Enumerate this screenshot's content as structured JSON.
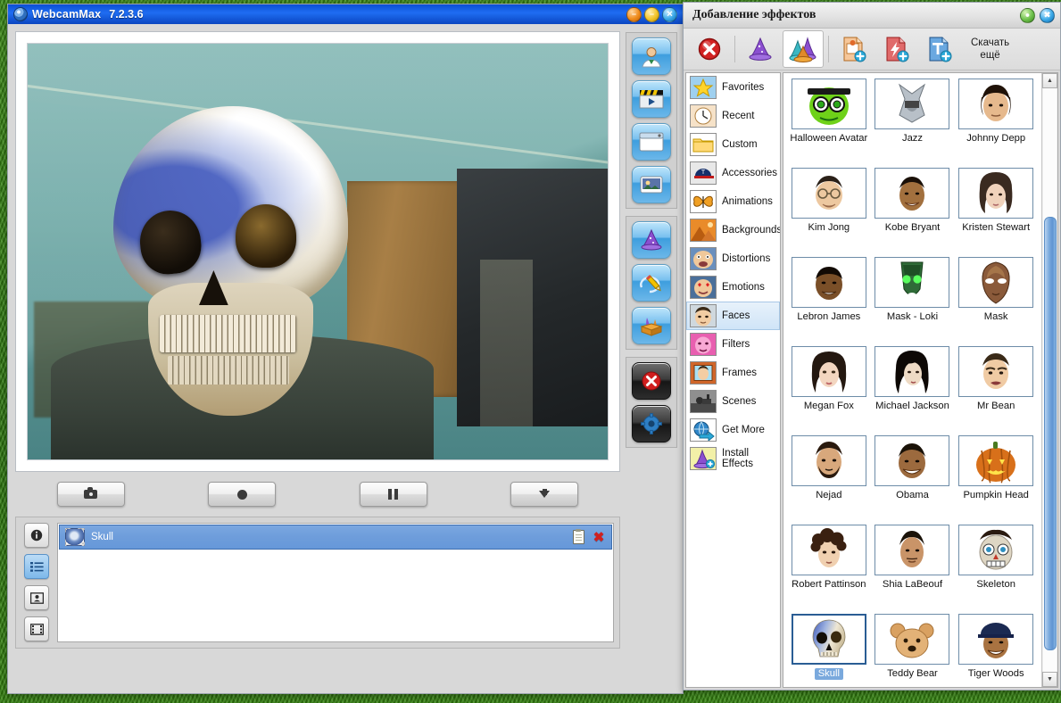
{
  "main_window": {
    "title": "WebcamMax",
    "version": "7.2.3.6",
    "window_buttons": [
      {
        "name": "minimize",
        "glyph": "–"
      },
      {
        "name": "maximize",
        "glyph": "–"
      },
      {
        "name": "close",
        "glyph": "✕"
      }
    ],
    "media_buttons": [
      {
        "name": "snapshot",
        "icon": "camera-icon"
      },
      {
        "name": "record",
        "icon": "record-icon"
      },
      {
        "name": "pause",
        "icon": "pause-icon"
      },
      {
        "name": "download",
        "icon": "download-arrow-icon"
      }
    ],
    "list_tools": [
      {
        "name": "info",
        "icon": "info-icon",
        "selected": false
      },
      {
        "name": "list",
        "icon": "list-icon",
        "selected": true
      },
      {
        "name": "image",
        "icon": "image-icon",
        "selected": false
      },
      {
        "name": "film",
        "icon": "film-icon",
        "selected": false
      }
    ],
    "active_effects": [
      {
        "name": "Skull",
        "copy_icon": "clipboard-icon",
        "remove_icon": "red-x-icon"
      }
    ],
    "right_rail": [
      {
        "name": "webcam-source",
        "icon": "person-icon"
      },
      {
        "name": "video-clip",
        "icon": "clapperboard-icon"
      },
      {
        "name": "window-mode",
        "icon": "window-icon"
      },
      {
        "name": "media-gallery",
        "icon": "gallery-icon"
      },
      {
        "name": "effects",
        "icon": "wizard-hat-icon"
      },
      {
        "name": "draw",
        "icon": "pencil-swirl-icon"
      },
      {
        "name": "effect-box",
        "icon": "open-box-icon"
      },
      {
        "name": "clear-effects",
        "icon": "red-x-circle-icon"
      },
      {
        "name": "settings",
        "icon": "gear-icon"
      }
    ]
  },
  "effects_panel": {
    "title": "Добавление эффектов",
    "window_buttons": [
      {
        "name": "minimize",
        "color": "#6cc04a"
      },
      {
        "name": "close",
        "color": "#3aa9e8"
      }
    ],
    "toolbar": [
      {
        "name": "clear-effects",
        "icon": "red-x-circle-icon",
        "selected": false
      },
      {
        "name": "single-effect",
        "icon": "purple-hat-icon",
        "selected": false
      },
      {
        "name": "multi-effect",
        "icon": "multi-hat-icon",
        "selected": true
      },
      {
        "name": "add-image",
        "icon": "add-image-icon",
        "selected": false
      },
      {
        "name": "add-flash",
        "icon": "add-flash-icon",
        "selected": false
      },
      {
        "name": "add-text",
        "icon": "add-text-icon",
        "selected": false
      }
    ],
    "download_more_line1": "Скачать",
    "download_more_line2": "ещё",
    "categories": [
      {
        "label": "Favorites",
        "icon": "star-icon",
        "selected": false
      },
      {
        "label": "Recent",
        "icon": "clock-icon",
        "selected": false
      },
      {
        "label": "Custom",
        "icon": "folder-icon",
        "selected": false
      },
      {
        "label": "Accessories",
        "icon": "cap-icon",
        "selected": false
      },
      {
        "label": "Animations",
        "icon": "butterfly-icon",
        "selected": false
      },
      {
        "label": "Backgrounds",
        "icon": "desert-icon",
        "selected": false
      },
      {
        "label": "Distortions",
        "icon": "distorted-face-icon",
        "selected": false
      },
      {
        "label": "Emotions",
        "icon": "heart-eyes-face-icon",
        "selected": false
      },
      {
        "label": "Faces",
        "icon": "face-icon",
        "selected": true
      },
      {
        "label": "Filters",
        "icon": "pink-face-icon",
        "selected": false
      },
      {
        "label": "Frames",
        "icon": "framed-photo-icon",
        "selected": false
      },
      {
        "label": "Scenes",
        "icon": "scene-icon",
        "selected": false
      },
      {
        "label": "Get More",
        "icon": "globe-arrow-icon",
        "selected": false
      },
      {
        "label": "Install Effects",
        "icon": "hat-plus-icon",
        "selected": false
      }
    ],
    "effects": [
      {
        "label": "Halloween Avatar",
        "thumb": "green-monster",
        "selected": false
      },
      {
        "label": "Jazz",
        "thumb": "silver-helmet",
        "selected": false
      },
      {
        "label": "Johnny Depp",
        "thumb": "dark-hair-man",
        "selected": false
      },
      {
        "label": "Kim Jong",
        "thumb": "glasses-man",
        "selected": false
      },
      {
        "label": "Kobe Bryant",
        "thumb": "smiling-man",
        "selected": false
      },
      {
        "label": "Kristen Stewart",
        "thumb": "bob-hair-woman",
        "selected": false
      },
      {
        "label": "Lebron James",
        "thumb": "bald-man",
        "selected": false
      },
      {
        "label": "Mask - Loki",
        "thumb": "green-glow-mask",
        "selected": false
      },
      {
        "label": "Mask",
        "thumb": "ornate-mask",
        "selected": false
      },
      {
        "label": "Megan Fox",
        "thumb": "dark-hair-woman",
        "selected": false
      },
      {
        "label": "Michael Jackson",
        "thumb": "long-black-hair",
        "selected": false
      },
      {
        "label": "Mr Bean",
        "thumb": "grimace-man",
        "selected": false
      },
      {
        "label": "Nejad",
        "thumb": "bearded-man",
        "selected": false
      },
      {
        "label": "Obama",
        "thumb": "grinning-man",
        "selected": false
      },
      {
        "label": "Pumpkin Head",
        "thumb": "jack-o-lantern",
        "selected": false
      },
      {
        "label": "Robert Pattinson",
        "thumb": "curly-hair-man",
        "selected": false
      },
      {
        "label": "Shia LaBeouf",
        "thumb": "short-hair-man",
        "selected": false
      },
      {
        "label": "Skeleton",
        "thumb": "cartoon-skeleton",
        "selected": false
      },
      {
        "label": "Skull",
        "thumb": "blue-skull",
        "selected": true
      },
      {
        "label": "Teddy Bear",
        "thumb": "teddy-bear",
        "selected": false
      },
      {
        "label": "Tiger Woods",
        "thumb": "capped-man",
        "selected": false
      }
    ],
    "scrollbar": {
      "up": "▲",
      "down": "▼"
    }
  }
}
